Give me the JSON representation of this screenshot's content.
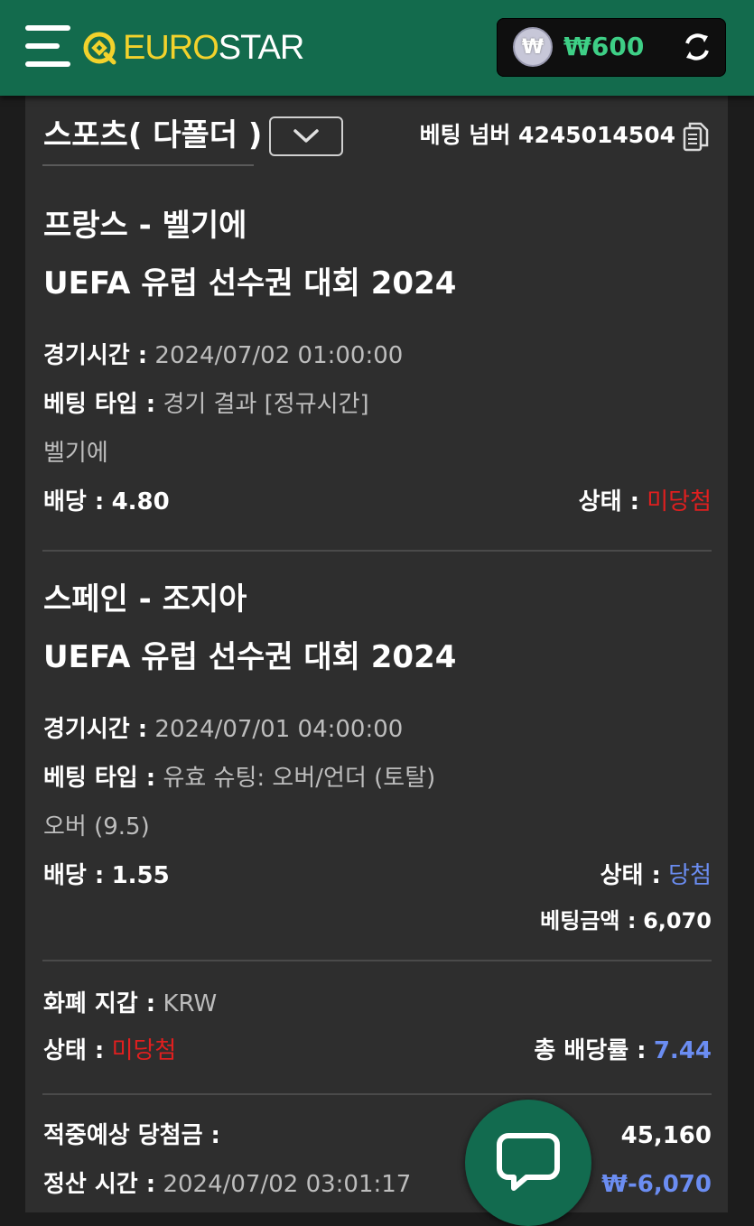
{
  "header": {
    "logo_euro": "EURO",
    "logo_star": "STAR",
    "currency_symbol": "₩",
    "balance": "₩600"
  },
  "bet": {
    "sport_title": "스포츠( 다폴더 )",
    "bet_number_label": "베팅 넘버",
    "bet_number": "4245014504"
  },
  "selections": [
    {
      "match": "프랑스 - 벨기에",
      "league": "UEFA 유럽 선수권 대회 2024",
      "time_label": "경기시간 :",
      "time": "2024/07/02 01:00:00",
      "type_label": "베팅 타입 :",
      "type": "경기 결과 [정규시간]",
      "pick": "벨기에",
      "odds_label": "배당 :",
      "odds": "4.80",
      "status_label": "상태 :",
      "status": "미당첨"
    },
    {
      "match": "스페인 - 조지아",
      "league": "UEFA 유럽 선수권 대회 2024",
      "time_label": "경기시간 :",
      "time": "2024/07/01 04:00:00",
      "type_label": "베팅 타입 :",
      "type": "유효 슈팅: 오버/언더 (토탈)",
      "pick": "오버 (9.5)",
      "odds_label": "배당 :",
      "odds": "1.55",
      "status_label": "상태 :",
      "status": "당첨",
      "stake_label": "베팅금액 :",
      "stake": "6,070"
    }
  ],
  "summary": {
    "wallet_label": "화폐 지갑 :",
    "wallet": "KRW",
    "status_label": "상태 :",
    "status": "미당첨",
    "total_odds_label": "총 배당률 :",
    "total_odds": "7.44",
    "expected_win_label": "적중예상 당첨금 :",
    "expected_win": "45,160",
    "settle_time_label": "정산 시간 :",
    "settle_time": "2024/07/02 03:01:17",
    "settle_amount": "₩-6,070"
  },
  "colors": {
    "header_green": "#136b4d",
    "panel": "#2e2e2e",
    "lost_red": "#e01f1f",
    "won_blue": "#6b8df2",
    "balance_green": "#3ecf86",
    "logo_yellow": "#f2d22c"
  },
  "icons": [
    "hamburger-menu-icon",
    "logo-q-icon",
    "won-coin-icon",
    "refresh-icon",
    "chevron-down-icon",
    "copy-icon",
    "chat-bubble-icon"
  ]
}
